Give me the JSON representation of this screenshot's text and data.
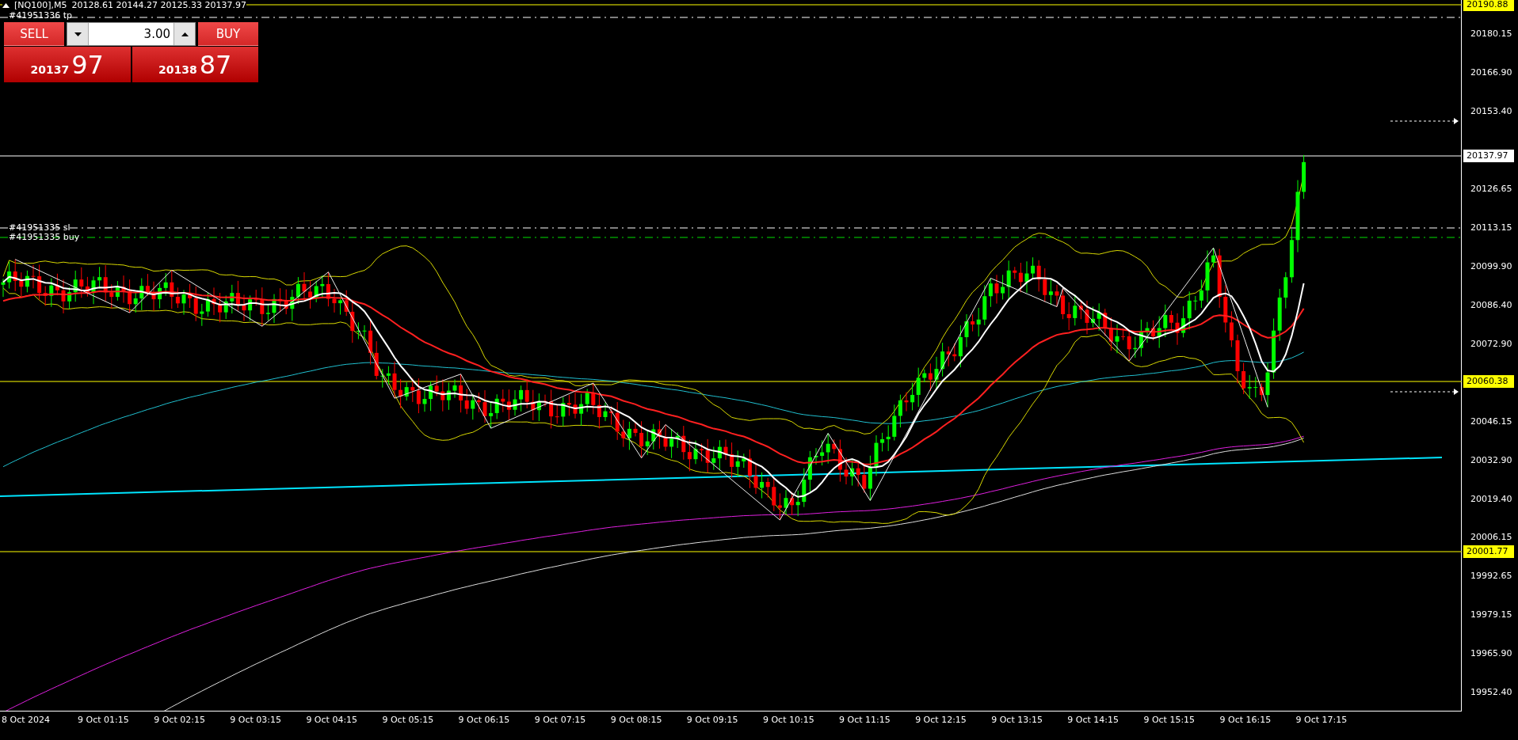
{
  "chart_header": {
    "title": "[NQ100],M5",
    "ohlc": "20128.61 20144.27 20125.33 20137.97"
  },
  "trade_panel": {
    "sell_label": "SELL",
    "buy_label": "BUY",
    "lot_size": "3.00",
    "bid_main": "20137",
    "bid_pips": "97",
    "ask_main": "20138",
    "ask_pips": "87"
  },
  "order_labels": [
    {
      "text": "#41951336 tp"
    },
    {
      "text": "#41951335 sl"
    },
    {
      "text": "#41951335 buy"
    }
  ],
  "price_axis": {
    "ticks": [
      "20180.15",
      "20166.90",
      "20153.40",
      "20126.65",
      "20113.15",
      "20099.90",
      "20086.40",
      "20072.90",
      "20046.15",
      "20032.90",
      "20019.40",
      "20006.15",
      "19992.65",
      "19979.15",
      "19965.90",
      "19952.40"
    ],
    "price_labels": [
      {
        "label": "20190.88",
        "color": "#ffff00"
      },
      {
        "label": "20137.97",
        "color": "#ffffff"
      },
      {
        "label": "20060.38",
        "color": "#ffff00"
      },
      {
        "label": "20001.77",
        "color": "#ffff00"
      }
    ]
  },
  "time_axis": {
    "labels": [
      "8 Oct 2024",
      "9 Oct 01:15",
      "9 Oct 02:15",
      "9 Oct 03:15",
      "9 Oct 04:15",
      "9 Oct 05:15",
      "9 Oct 06:15",
      "9 Oct 07:15",
      "9 Oct 08:15",
      "9 Oct 09:15",
      "9 Oct 10:15",
      "9 Oct 11:15",
      "9 Oct 12:15",
      "9 Oct 13:15",
      "9 Oct 14:15",
      "9 Oct 15:15",
      "9 Oct 16:15",
      "9 Oct 17:15"
    ]
  }
}
